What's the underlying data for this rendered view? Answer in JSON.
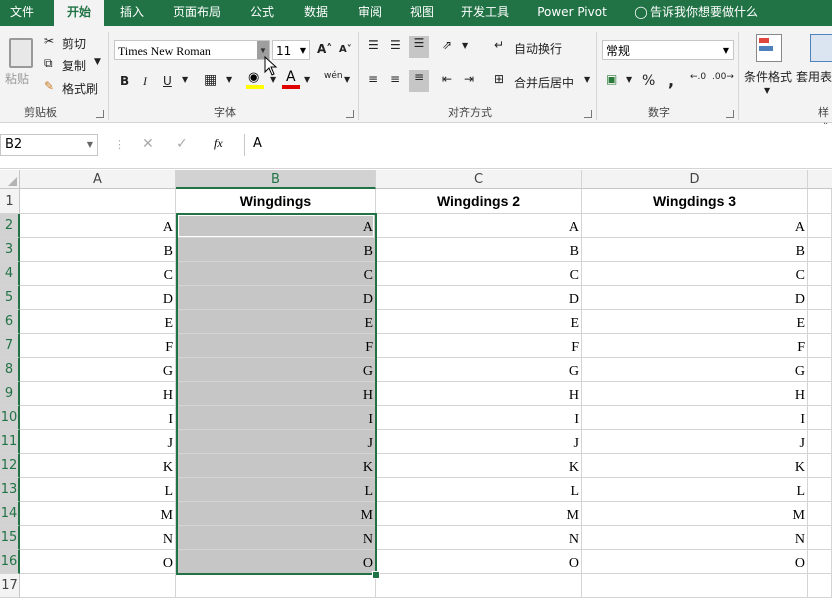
{
  "tabs": [
    "文件",
    "开始",
    "插入",
    "页面布局",
    "公式",
    "数据",
    "审阅",
    "视图",
    "开发工具",
    "Power Pivot",
    "告诉我你想要做什么"
  ],
  "clipboard": {
    "paste": "粘贴",
    "cut": "剪切",
    "copy": "复制",
    "format_painter": "格式刷",
    "label": "剪贴板"
  },
  "font": {
    "name": "Times New Roman",
    "size": "11",
    "label": "字体",
    "bold": "B",
    "italic": "I",
    "underline": "U",
    "font_color": "A",
    "wen": "wén"
  },
  "alignment": {
    "wrap": "自动换行",
    "merge": "合并后居中",
    "label": "对齐方式"
  },
  "number": {
    "format": "常规",
    "percent": "%",
    "comma": ",",
    "label": "数字"
  },
  "styles": {
    "conditional": "条件格式",
    "table": "套用表格格式",
    "label": "样式"
  },
  "formula_bar": {
    "name_box": "B2",
    "content": "A",
    "fx": "fx"
  },
  "columns": [
    "A",
    "B",
    "C",
    "D"
  ],
  "headers": [
    "",
    "Wingdings",
    "Wingdings 2",
    "Wingdings 3"
  ],
  "row_numbers": [
    "1",
    "2",
    "3",
    "4",
    "5",
    "6",
    "7",
    "8",
    "9",
    "10",
    "11",
    "12",
    "13",
    "14",
    "15",
    "16",
    "17"
  ],
  "letters": [
    "A",
    "B",
    "C",
    "D",
    "E",
    "F",
    "G",
    "H",
    "I",
    "J",
    "K",
    "L",
    "M",
    "N",
    "O"
  ]
}
